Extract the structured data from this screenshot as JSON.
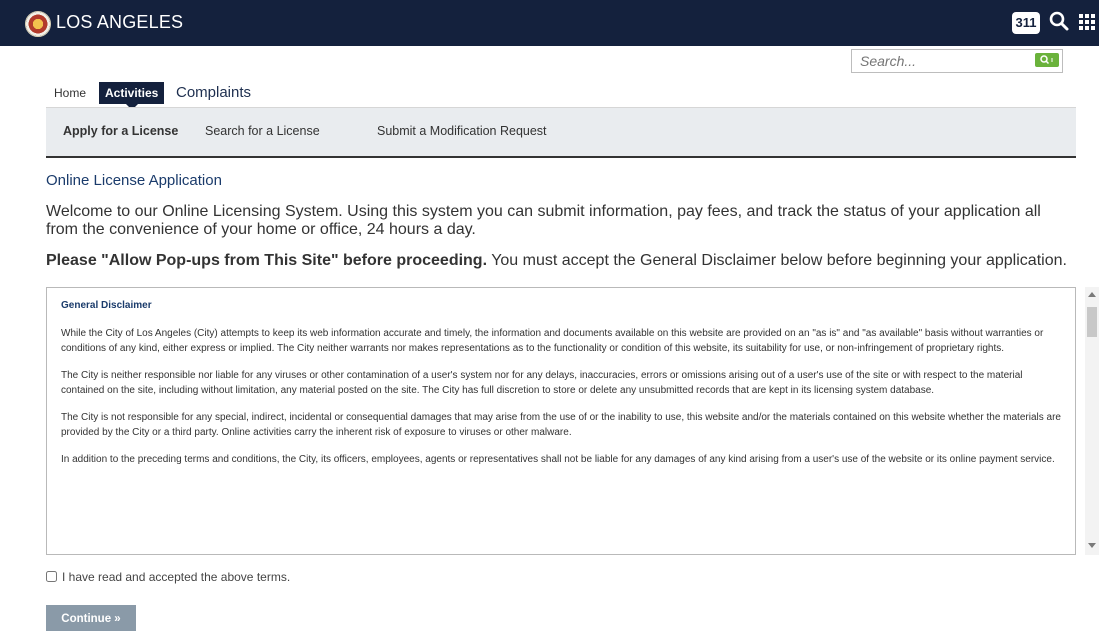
{
  "header": {
    "brand": "LOS ANGELES",
    "badge": "311",
    "bg_color": "#14213d"
  },
  "search": {
    "placeholder": "Search..."
  },
  "tabs": [
    {
      "label": "Home"
    },
    {
      "label": "Activities",
      "active": true
    },
    {
      "label": "Complaints"
    }
  ],
  "subnav": [
    {
      "label": "Apply for a License",
      "active": true
    },
    {
      "label": "Search for a License"
    },
    {
      "label": "Submit a Modification Request"
    }
  ],
  "main": {
    "section_title": "Online License Application",
    "welcome": "Welcome to our Online Licensing System. Using this system you can submit information, pay fees, and track the status of your application all from the convenience of your home or office, 24 hours a day.",
    "popups_bold": "Please \"Allow Pop-ups from This Site\" before proceeding.",
    "popups_rest": " You must accept the General Disclaimer below before beginning your application."
  },
  "disclaimer": {
    "title": "General Disclaimer",
    "paragraphs": [
      "While the City of Los Angeles (City) attempts to keep its web information accurate and timely, the information and documents available on this website are provided on an \"as is\" and \"as available\" basis without warranties or conditions of any kind, either express or implied. The City neither warrants nor makes representations as to the functionality or condition of this website, its suitability for use, or non-infringement of proprietary rights.",
      "The City is neither responsible nor liable for any viruses or other contamination of a user's system nor for any delays, inaccuracies, errors or omissions arising out of a user's use of the site or with respect to the material contained on the site, including without limitation, any material posted on the site. The City has full discretion to store or delete any unsubmitted records that are kept in its licensing system database.",
      "The City is not responsible for any special, indirect, incidental or consequential damages that may arise from the use of or the inability to use, this website and/or the materials contained on this website whether the materials are provided by the City or a third party. Online activities carry the inherent risk of exposure to viruses or other malware.",
      "In addition to the preceding terms and conditions, the City, its officers, employees, agents or representatives shall not be liable for any damages of any kind arising from a user's use of the website or its online payment service."
    ]
  },
  "accept_label": "I have read and accepted the above terms.",
  "continue_label": "Continue »"
}
